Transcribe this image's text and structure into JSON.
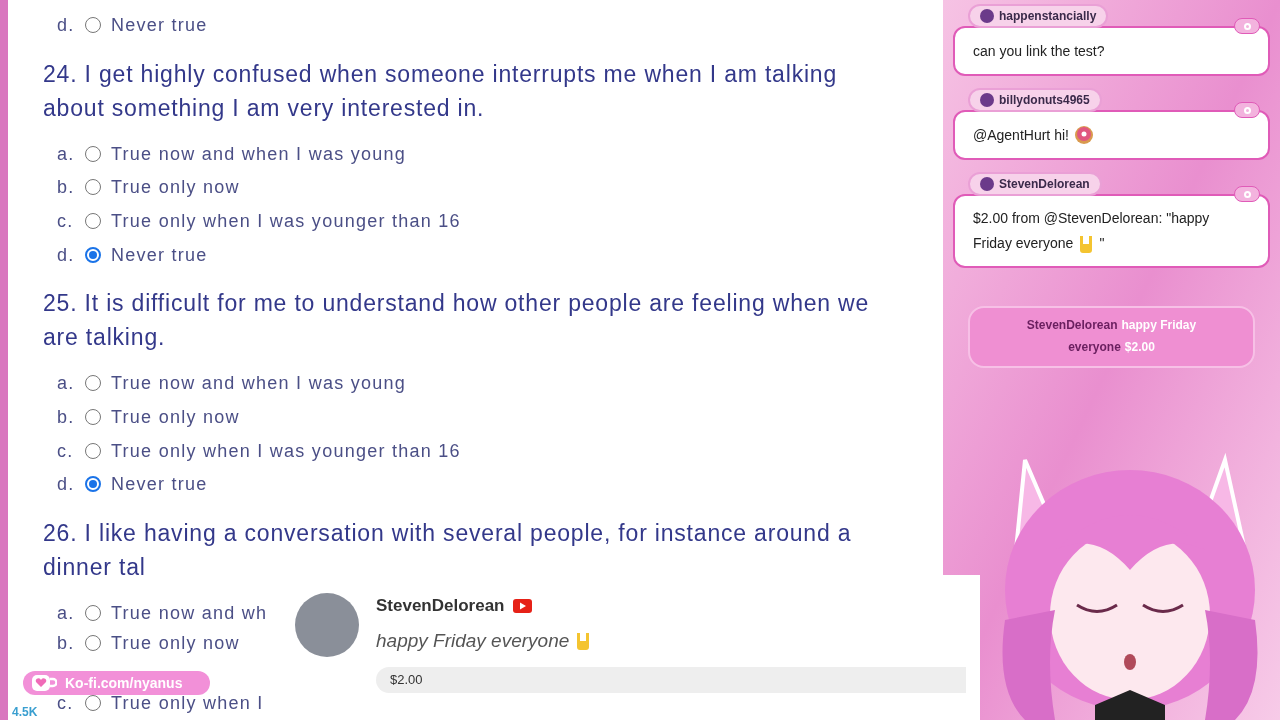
{
  "top_option": {
    "letter": "d.",
    "label": "Never true",
    "selected": false
  },
  "questions": [
    {
      "number": "24.",
      "text": "I get highly confused when someone interrupts me when I am talking about something I am very interested in.",
      "options": [
        {
          "letter": "a.",
          "label": "True now and when I was young",
          "selected": false
        },
        {
          "letter": "b.",
          "label": "True only now",
          "selected": false
        },
        {
          "letter": "c.",
          "label": "True only when I was younger than 16",
          "selected": false
        },
        {
          "letter": "d.",
          "label": "Never true",
          "selected": true
        }
      ]
    },
    {
      "number": "25.",
      "text": "It is difficult for me to understand how other people are feeling when we are talking.",
      "options": [
        {
          "letter": "a.",
          "label": "True now and when I was young",
          "selected": false
        },
        {
          "letter": "b.",
          "label": "True only now",
          "selected": false
        },
        {
          "letter": "c.",
          "label": "True only when I was younger than 16",
          "selected": false
        },
        {
          "letter": "d.",
          "label": "Never true",
          "selected": true
        }
      ]
    },
    {
      "number": "26.",
      "text": "I like having a conversation with several people, for instance around a dinner tal",
      "options": [
        {
          "letter": "a.",
          "label": "True now and wh",
          "selected": false
        },
        {
          "letter": "b.",
          "label": "True only now",
          "selected": false
        },
        {
          "letter": "c.",
          "label": "True only when I",
          "selected": false
        }
      ]
    }
  ],
  "chat": {
    "messages": [
      {
        "user": "happenstancially",
        "parts": [
          {
            "kind": "text",
            "text": "can you link the test?"
          }
        ]
      },
      {
        "user": "billydonuts4965",
        "parts": [
          {
            "kind": "text",
            "text": "@AgentHurt hi!"
          },
          {
            "kind": "donut"
          }
        ]
      },
      {
        "user": "StevenDelorean",
        "parts": [
          {
            "kind": "text",
            "text": "$2.00 from @StevenDelorean: \"happy"
          },
          {
            "kind": "text",
            "text": "Friday everyone"
          },
          {
            "kind": "rock-hand"
          },
          {
            "kind": "text",
            "text": "\""
          }
        ]
      }
    ],
    "alert": {
      "name": "StevenDelorean",
      "message": "happy Friday",
      "line2": "everyone",
      "amount": "$2.00"
    }
  },
  "donation_popup": {
    "name": "StevenDelorean",
    "message": "happy Friday everyone",
    "amount": "$2.00"
  },
  "kofi_badge": {
    "label": "Ko-fi.com/nyanus"
  },
  "counter": "4.5K"
}
